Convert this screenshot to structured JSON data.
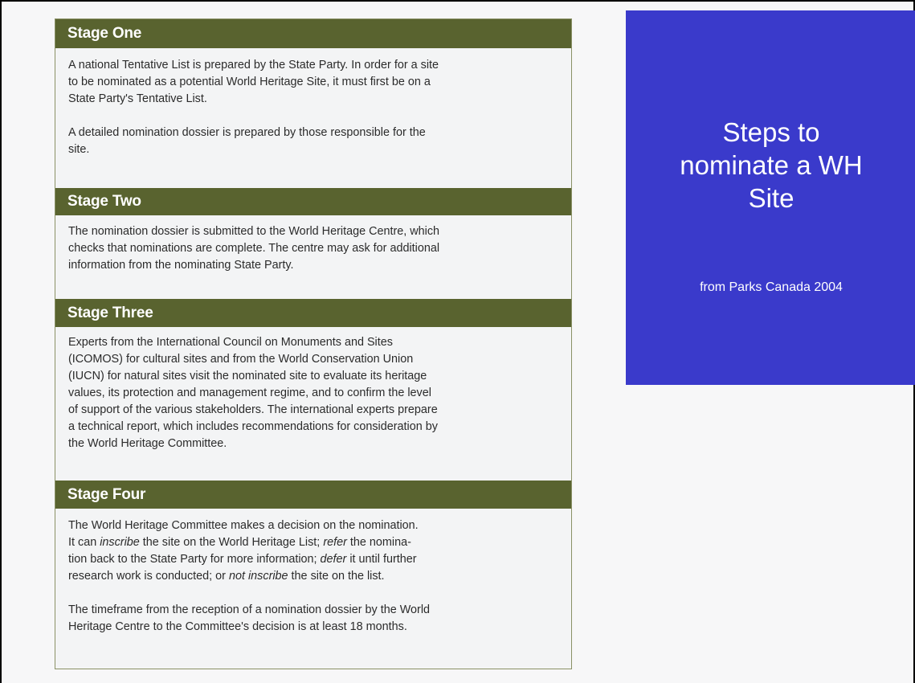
{
  "stages": [
    {
      "title": "Stage One",
      "paragraphs": [
        [
          "A national Tentative List is prepared by the State Party. In order for a site",
          "to be nominated as a potential World Heritage Site, it must first be on a",
          "State Party's Tentative List."
        ],
        [
          "A detailed nomination dossier is prepared by those responsible for the",
          "site."
        ]
      ]
    },
    {
      "title": "Stage Two",
      "paragraphs": [
        [
          "The nomination dossier is submitted to the World Heritage Centre, which",
          "checks that nominations are complete. The centre may ask for additional",
          "information from the nominating State Party."
        ]
      ]
    },
    {
      "title": "Stage Three",
      "paragraphs": [
        [
          "Experts from the International Council on Monuments and Sites",
          "(ICOMOS) for cultural sites and from the World Conservation Union",
          "(IUCN) for natural sites visit the nominated site to evaluate its heritage",
          "values, its protection and management regime, and to confirm the level",
          "of support of the various stakeholders. The international experts prepare",
          "a technical report, which includes recommendations for consideration by",
          "the World Heritage Committee."
        ]
      ]
    },
    {
      "title": "Stage Four",
      "paragraphs": [
        [
          "The World Heritage Committee makes a decision on the nomination.",
          "It can *inscribe* the site on the World Heritage List; *refer* the nomina-",
          "tion back to the State Party for more information; *defer* it until further",
          "research work is conducted; or *not inscribe* the site on the list."
        ],
        [
          "The timeframe from the reception of a nomination dossier by the World",
          "Heritage Centre to the Committee's decision is at least 18 months."
        ]
      ]
    }
  ],
  "title_panel": {
    "heading_lines": [
      "Steps to",
      "nominate a WH",
      "Site"
    ],
    "subtitle": "from Parks Canada 2004"
  },
  "colors": {
    "stage_header_bg": "#59632f",
    "title_panel_bg": "#3a3acb",
    "page_bg": "#f7f7f8"
  }
}
